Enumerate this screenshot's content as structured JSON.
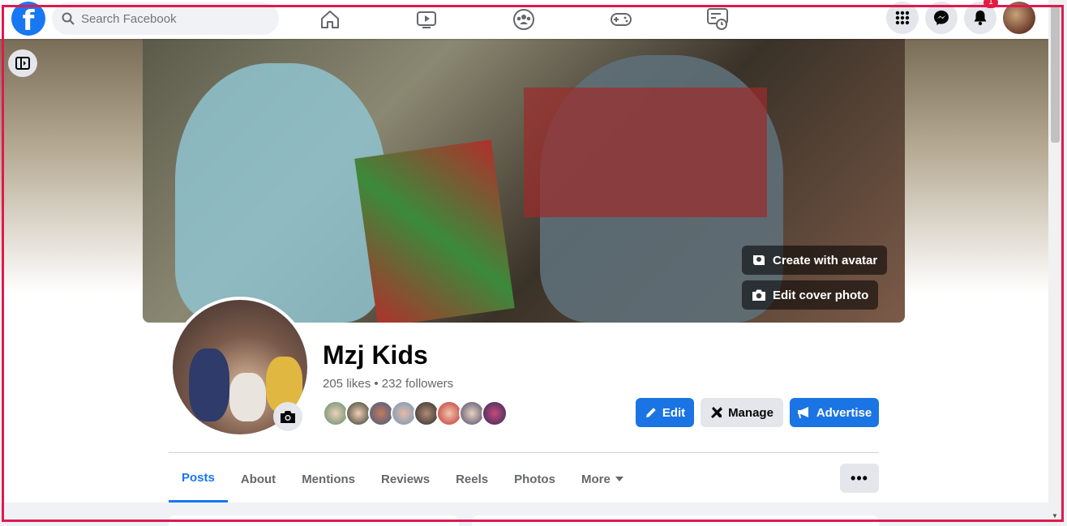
{
  "topbar": {
    "logo": "f",
    "search_placeholder": "Search Facebook",
    "nav_icons": [
      "home-icon",
      "watch-icon",
      "groups-icon",
      "gaming-icon",
      "feeds-icon"
    ],
    "notification_count": "1"
  },
  "cover": {
    "avatar_btn": "Create with avatar",
    "edit_cover_btn": "Edit cover photo"
  },
  "profile": {
    "name": "Mzj Kids",
    "stats": "205 likes • 232 followers"
  },
  "actions": {
    "edit": "Edit",
    "manage": "Manage",
    "advertise": "Advertise"
  },
  "tabs": [
    {
      "label": "Posts",
      "active": true
    },
    {
      "label": "About"
    },
    {
      "label": "Mentions"
    },
    {
      "label": "Reviews"
    },
    {
      "label": "Reels"
    },
    {
      "label": "Photos"
    },
    {
      "label": "More"
    }
  ],
  "more_button": "•••",
  "colors": {
    "brand": "#1877f2",
    "button_primary": "#1b74e4",
    "badge": "#e41e3f"
  }
}
